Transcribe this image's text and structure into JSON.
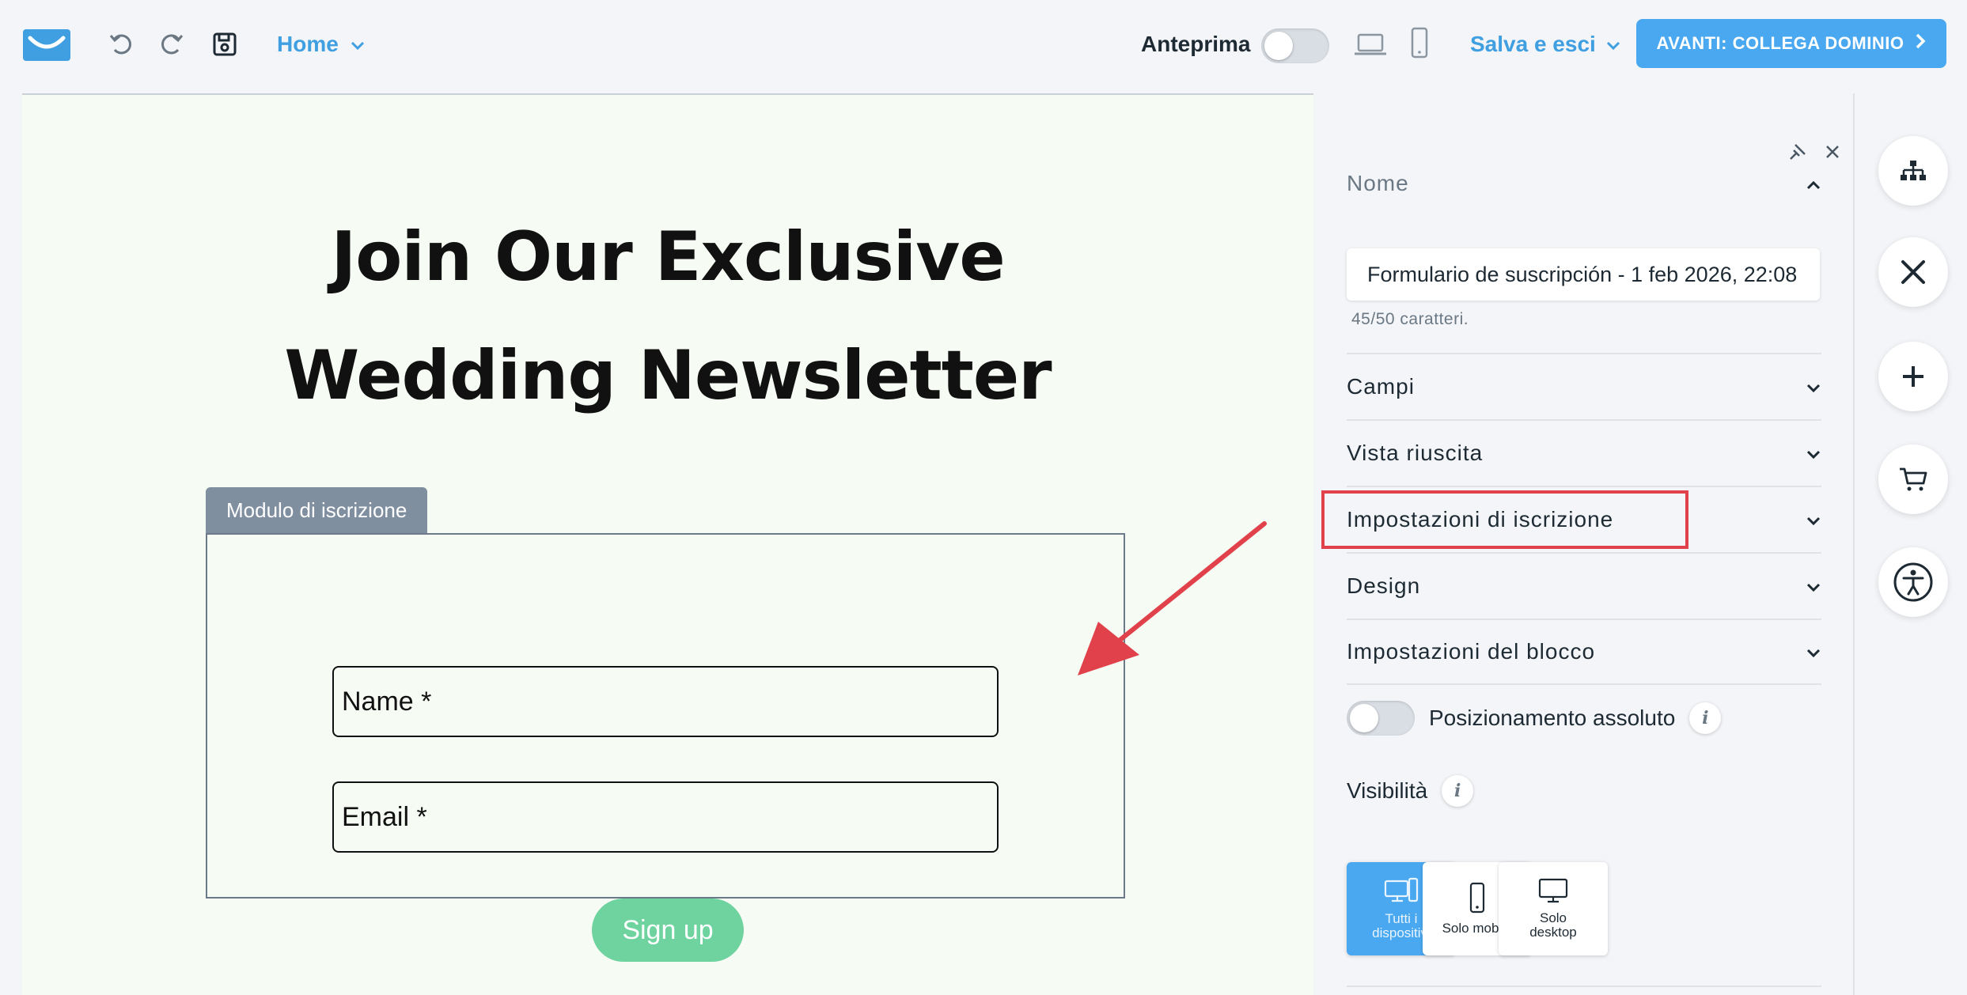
{
  "topbar": {
    "home_label": "Home",
    "preview_label": "Anteprima",
    "save_exit_label": "Salva e esci",
    "cta_label": "AVANTI: COLLEGA DOMINIO",
    "icons": [
      "logo-icon",
      "undo-icon",
      "redo-icon",
      "save-icon",
      "laptop-icon",
      "mobile-icon"
    ]
  },
  "canvas": {
    "headline_line1": "Join Our Exclusive",
    "headline_line2": "Wedding Newsletter",
    "form_tab_label": "Modulo di iscrizione",
    "name_field": "Name *",
    "email_field": "Email *",
    "signup_label": "Sign up"
  },
  "panel": {
    "nome_label": "Nome",
    "name_value": "Formulario de suscripción - 1 feb 2026, 22:08",
    "counter": "45/50 caratteri.",
    "sections": [
      "Campi",
      "Vista riuscita",
      "Impostazioni di iscrizione",
      "Design",
      "Impostazioni del blocco"
    ],
    "absolute_label": "Posizionamento assoluto",
    "visibility_label": "Visibilità",
    "visibility_options": [
      "Tutti i dispositivi",
      "Solo mobile",
      "Solo desktop"
    ],
    "selected_visibility": "Tutti i dispositivi"
  },
  "rail": [
    "sitemap-icon",
    "tools-icon",
    "add-icon",
    "cart-icon",
    "accessibility-icon"
  ],
  "colors": {
    "accent": "#4aa8f0",
    "link": "#3f9fe0",
    "signup": "#6fd3a0",
    "highlight": "#e0414a",
    "canvas_bg": "#f6fcf4"
  }
}
